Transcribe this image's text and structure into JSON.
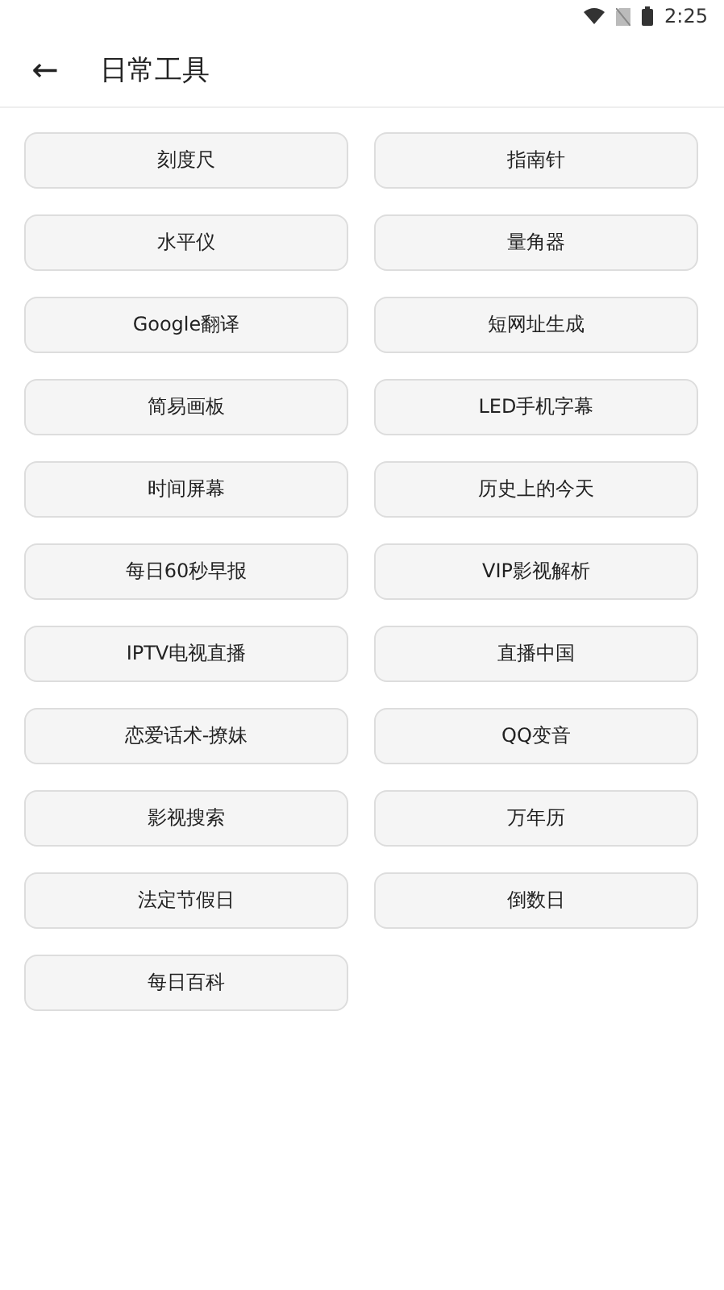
{
  "status_bar": {
    "time": "2:25"
  },
  "app_bar": {
    "back_glyph": "←",
    "title": "日常工具"
  },
  "tools": [
    "刻度尺",
    "指南针",
    "水平仪",
    "量角器",
    "Google翻译",
    "短网址生成",
    "简易画板",
    "LED手机字幕",
    "时间屏幕",
    "历史上的今天",
    "每日60秒早报",
    "VIP影视解析",
    "IPTV电视直播",
    "直播中国",
    "恋爱话术-撩妹",
    "QQ变音",
    "影视搜索",
    "万年历",
    "法定节假日",
    "倒数日",
    "每日百科"
  ]
}
